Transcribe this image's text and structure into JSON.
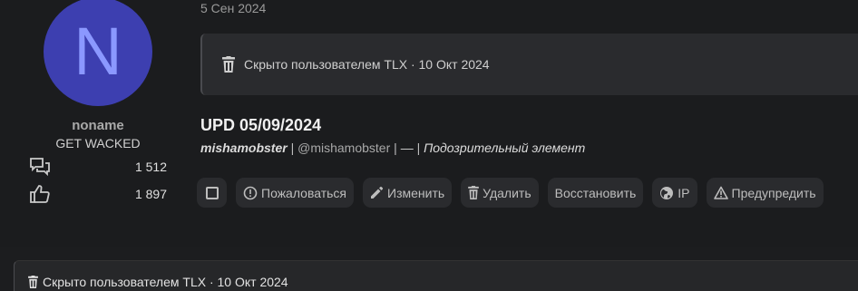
{
  "user": {
    "avatar_letter": "N",
    "name": "noname",
    "title": "GET WACKED",
    "messages_count": "1 512",
    "likes_count": "1 897"
  },
  "post": {
    "date": "5 Сен 2024",
    "hidden_notice": "Скрыто пользователем TLX · 10 Окт 2024",
    "title": "UPD 05/09/2024",
    "author": "mishamobster",
    "handle": "@mishamobster",
    "dash": "—",
    "status": "Подозрительный элемент"
  },
  "actions": {
    "report": "Пожаловаться",
    "edit": "Изменить",
    "delete": "Удалить",
    "restore": "Восстановить",
    "ip": "IP",
    "warn": "Предупредить"
  },
  "next_post": {
    "hidden_notice": "Скрыто пользователем TLX · 10 Окт 2024"
  },
  "colors": {
    "avatar_bg": "#3d3fb0",
    "avatar_letter": "#8b98ff",
    "page_bg": "#1c1d1f",
    "button_bg": "#2a2b2e"
  },
  "icons": {
    "messages": "chat-bubbles-icon",
    "likes": "thumbs-up-icon",
    "trash": "trash-icon",
    "report": "alert-circle-icon",
    "edit": "pencil-icon",
    "ip": "globe-icon",
    "warn": "warning-triangle-icon"
  }
}
